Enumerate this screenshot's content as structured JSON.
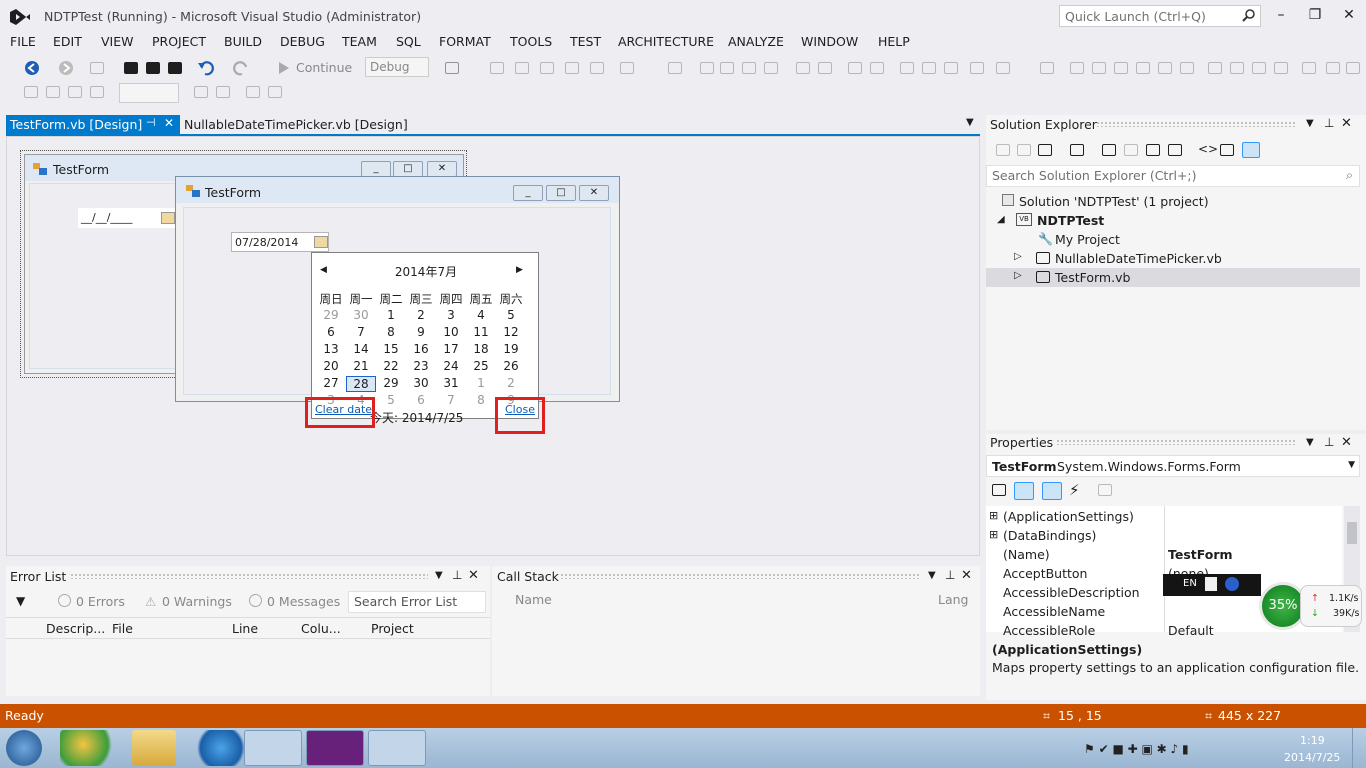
{
  "window": {
    "title": "NDTPTest (Running) - Microsoft Visual Studio (Administrator)",
    "quick_launch_placeholder": "Quick Launch (Ctrl+Q)"
  },
  "menu": [
    "FILE",
    "EDIT",
    "VIEW",
    "PROJECT",
    "BUILD",
    "DEBUG",
    "TEAM",
    "SQL",
    "FORMAT",
    "TOOLS",
    "TEST",
    "ARCHITECTURE",
    "ANALYZE",
    "WINDOW",
    "HELP"
  ],
  "toolbar": {
    "continue_label": "Continue",
    "config_value": "Debug"
  },
  "tabs": {
    "active": "TestForm.vb [Design]",
    "other": "NullableDateTimePicker.vb [Design]"
  },
  "designer": {
    "form_back_title": "TestForm",
    "form_back_mask": "__/__/____",
    "form_front_title": "TestForm",
    "dtp_value": "07/28/2014",
    "calendar": {
      "month_label": "2014年7月",
      "weekdays": [
        "周日",
        "周一",
        "周二",
        "周三",
        "周四",
        "周五",
        "周六"
      ],
      "weeks": [
        [
          "29",
          "30",
          "1",
          "2",
          "3",
          "4",
          "5"
        ],
        [
          "6",
          "7",
          "8",
          "9",
          "10",
          "11",
          "12"
        ],
        [
          "13",
          "14",
          "15",
          "16",
          "17",
          "18",
          "19"
        ],
        [
          "20",
          "21",
          "22",
          "23",
          "24",
          "25",
          "26"
        ],
        [
          "27",
          "28",
          "29",
          "30",
          "31",
          "1",
          "2"
        ],
        [
          "3",
          "4",
          "5",
          "6",
          "7",
          "8",
          "9"
        ]
      ],
      "selected_day": "28",
      "today_text": "今天: 2014/7/25",
      "clear_label": "Clear date",
      "close_label": "Close"
    }
  },
  "solution_explorer": {
    "title": "Solution Explorer",
    "search_placeholder": "Search Solution Explorer (Ctrl+;)",
    "items": [
      "Solution 'NDTPTest' (1 project)",
      "NDTPTest",
      "My Project",
      "NullableDateTimePicker.vb",
      "TestForm.vb"
    ]
  },
  "properties": {
    "title": "Properties",
    "object_name": "TestForm",
    "object_type": "System.Windows.Forms.Form",
    "rows": [
      {
        "name": "(ApplicationSettings)",
        "value": ""
      },
      {
        "name": "(DataBindings)",
        "value": ""
      },
      {
        "name": "(Name)",
        "value": "TestForm"
      },
      {
        "name": "AcceptButton",
        "value": "(none)"
      },
      {
        "name": "AccessibleDescription",
        "value": ""
      },
      {
        "name": "AccessibleName",
        "value": ""
      },
      {
        "name": "AccessibleRole",
        "value": "Default"
      }
    ],
    "desc_title": "(ApplicationSettings)",
    "desc_text": "Maps property settings to an application configuration file."
  },
  "error_list": {
    "title": "Error List",
    "errors": "0 Errors",
    "warnings": "0 Warnings",
    "messages": "0 Messages",
    "search_placeholder": "Search Error List",
    "columns": [
      "Descrip...",
      "File",
      "Line",
      "Colu...",
      "Project"
    ]
  },
  "call_stack": {
    "title": "Call Stack",
    "columns": [
      "Name",
      "Lang"
    ]
  },
  "status": {
    "ready": "Ready",
    "position": "15 , 15",
    "size": "445 x 227"
  },
  "taskbar": {
    "time": "1:19",
    "date": "2014/7/25"
  },
  "overlay": {
    "lang": "EN",
    "gauge": "35%",
    "up": "1.1K/s",
    "down": "39K/s"
  },
  "colors": {
    "accent": "#007acc",
    "status_bar": "#ca5100",
    "highlight_box": "#e0201e"
  }
}
